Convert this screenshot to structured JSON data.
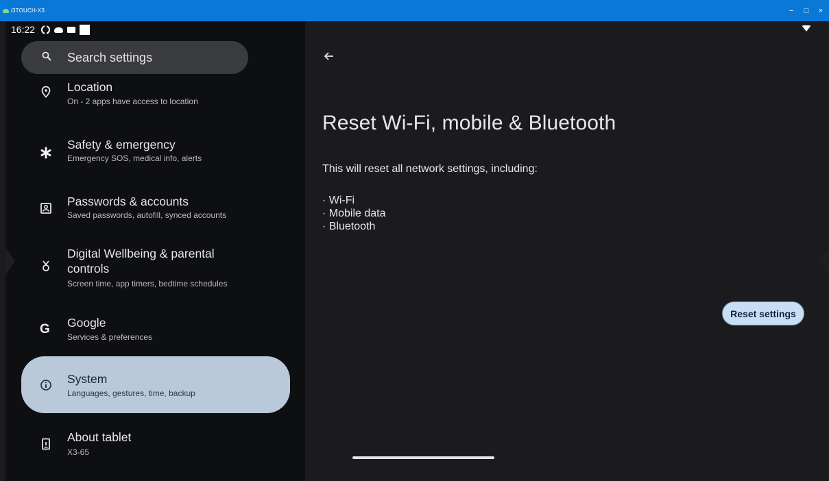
{
  "window": {
    "title": "i3TOUCH-X3",
    "min": "−",
    "max": "□",
    "close": "×"
  },
  "status": {
    "time": "16:22"
  },
  "search": {
    "placeholder": "Search settings"
  },
  "settings_items": [
    {
      "icon": "location-icon",
      "title": "Location",
      "subtitle": "On - 2 apps have access to location"
    },
    {
      "icon": "asterisk-icon",
      "title": "Safety & emergency",
      "subtitle": "Emergency SOS, medical info, alerts"
    },
    {
      "icon": "account-box-icon",
      "title": "Passwords & accounts",
      "subtitle": "Saved passwords, autofill, synced accounts"
    },
    {
      "icon": "wellbeing-icon",
      "title_line1": "Digital Wellbeing & parental",
      "title_line2": "controls",
      "subtitle": "Screen time, app timers, bedtime schedules"
    },
    {
      "icon": "google-g-icon",
      "title": "Google",
      "subtitle": "Services & preferences"
    },
    {
      "icon": "info-icon",
      "title": "System",
      "subtitle": "Languages, gestures, time, backup",
      "selected": true
    },
    {
      "icon": "tablet-icon",
      "title": "About tablet",
      "subtitle": "X3-65"
    }
  ],
  "detail": {
    "title": "Reset Wi-Fi, mobile & Bluetooth",
    "description": "This will reset all network settings, including:",
    "bullets": [
      "· Wi-Fi",
      "· Mobile data",
      "· Bluetooth"
    ],
    "button_label": "Reset settings"
  },
  "colors": {
    "titlebar": "#0a78d7",
    "selected_item": "#b9c9da",
    "button": "#c8ddf6"
  }
}
